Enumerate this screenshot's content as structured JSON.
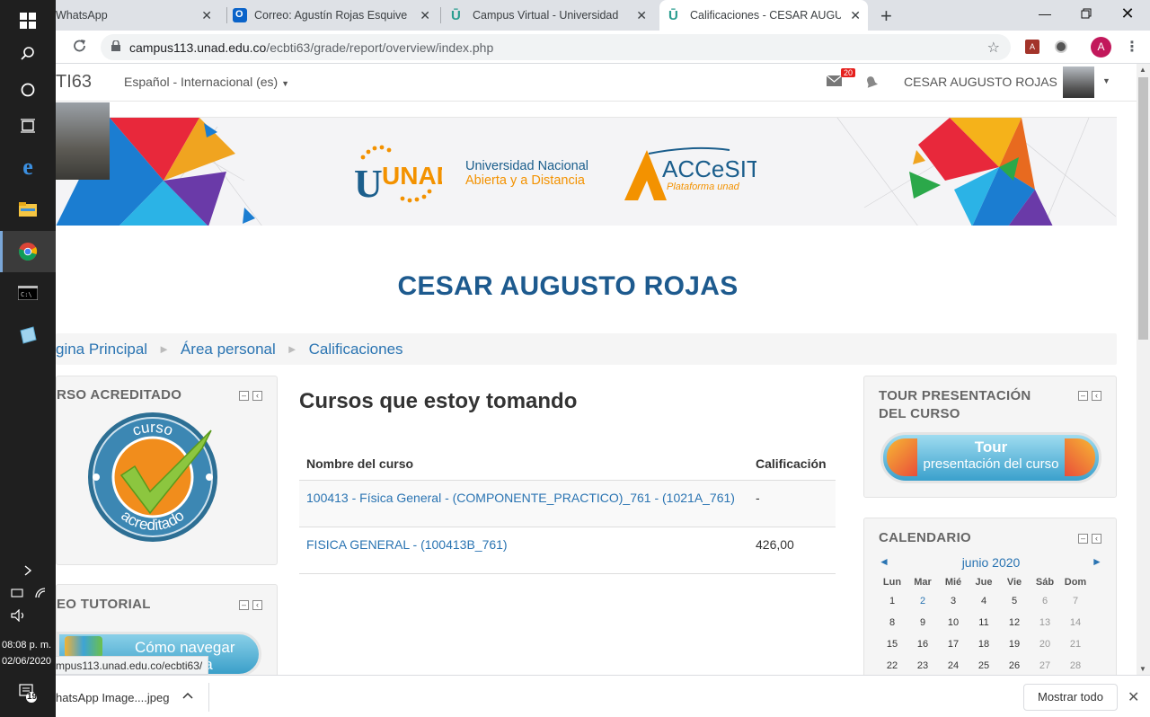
{
  "taskbar": {
    "clock_time": "08:08 p. m.",
    "clock_date": "02/06/2020",
    "notification_count": "19"
  },
  "tabs": [
    {
      "title": "WhatsApp"
    },
    {
      "title": "Correo: Agustín Rojas Esquivel - C"
    },
    {
      "title": "Campus Virtual - Universidad Na"
    },
    {
      "title": "Calificaciones - CESAR AUGUSTO"
    }
  ],
  "address_bar": {
    "url_host": "campus113.unad.edu.co",
    "url_path": "/ecbti63/grade/report/overview/index.php",
    "profile_initial": "A"
  },
  "header": {
    "site_short": "TI63",
    "language": "Español - Internacional (es)",
    "message_count": "20",
    "user_name": "CESAR AUGUSTO ROJAS"
  },
  "banner": {
    "unad_logo": "UNAD",
    "unad_line1": "Universidad Nacional",
    "unad_line2": "Abierta y a Distancia",
    "accesit_logo": "ACCeSIT",
    "accesit_sub": "Plataforma unad"
  },
  "page_title": "CESAR AUGUSTO ROJAS",
  "breadcrumb": [
    "gina Principal",
    "Área personal",
    "Calificaciones"
  ],
  "blocks": {
    "left_top_title": "RSO ACREDITADO",
    "badge_top": "curso",
    "badge_bottom": "acreditado",
    "left_bottom_title": "EO TUTORIAL",
    "tutorial_line1": "Cómo navegar",
    "tutorial_line2": "ula",
    "tour_title": "TOUR PRESENTACIÓN DEL CURSO",
    "tour_line1": "Tour",
    "tour_line2": "presentación del curso",
    "calendar_title": "CALENDARIO"
  },
  "main": {
    "heading": "Cursos que estoy tomando",
    "col_course": "Nombre del curso",
    "col_grade": "Calificación",
    "rows": [
      {
        "course": "100413 - Física General - (COMPONENTE_PRACTICO)_761 - (1021A_761)",
        "grade": "-"
      },
      {
        "course": "FISICA GENERAL - (100413B_761)",
        "grade": "426,00"
      }
    ]
  },
  "calendar": {
    "month": "junio 2020",
    "prev": "◄",
    "next": "►",
    "days": [
      "Lun",
      "Mar",
      "Mié",
      "Jue",
      "Vie",
      "Sáb",
      "Dom"
    ],
    "weeks": [
      [
        "1",
        "2",
        "3",
        "4",
        "5",
        "6",
        "7"
      ],
      [
        "8",
        "9",
        "10",
        "11",
        "12",
        "13",
        "14"
      ],
      [
        "15",
        "16",
        "17",
        "18",
        "19",
        "20",
        "21"
      ],
      [
        "22",
        "23",
        "24",
        "25",
        "26",
        "27",
        "28"
      ]
    ]
  },
  "status_url": "mpus113.unad.edu.co/ecbti63/",
  "downloads": {
    "file": "hatsApp Image....jpeg",
    "show_all": "Mostrar todo"
  },
  "colors": {
    "link": "#2a74b2",
    "title_blue": "#1d5a8e",
    "unad_orange": "#f39200",
    "unad_blue": "#1b5e8c"
  }
}
